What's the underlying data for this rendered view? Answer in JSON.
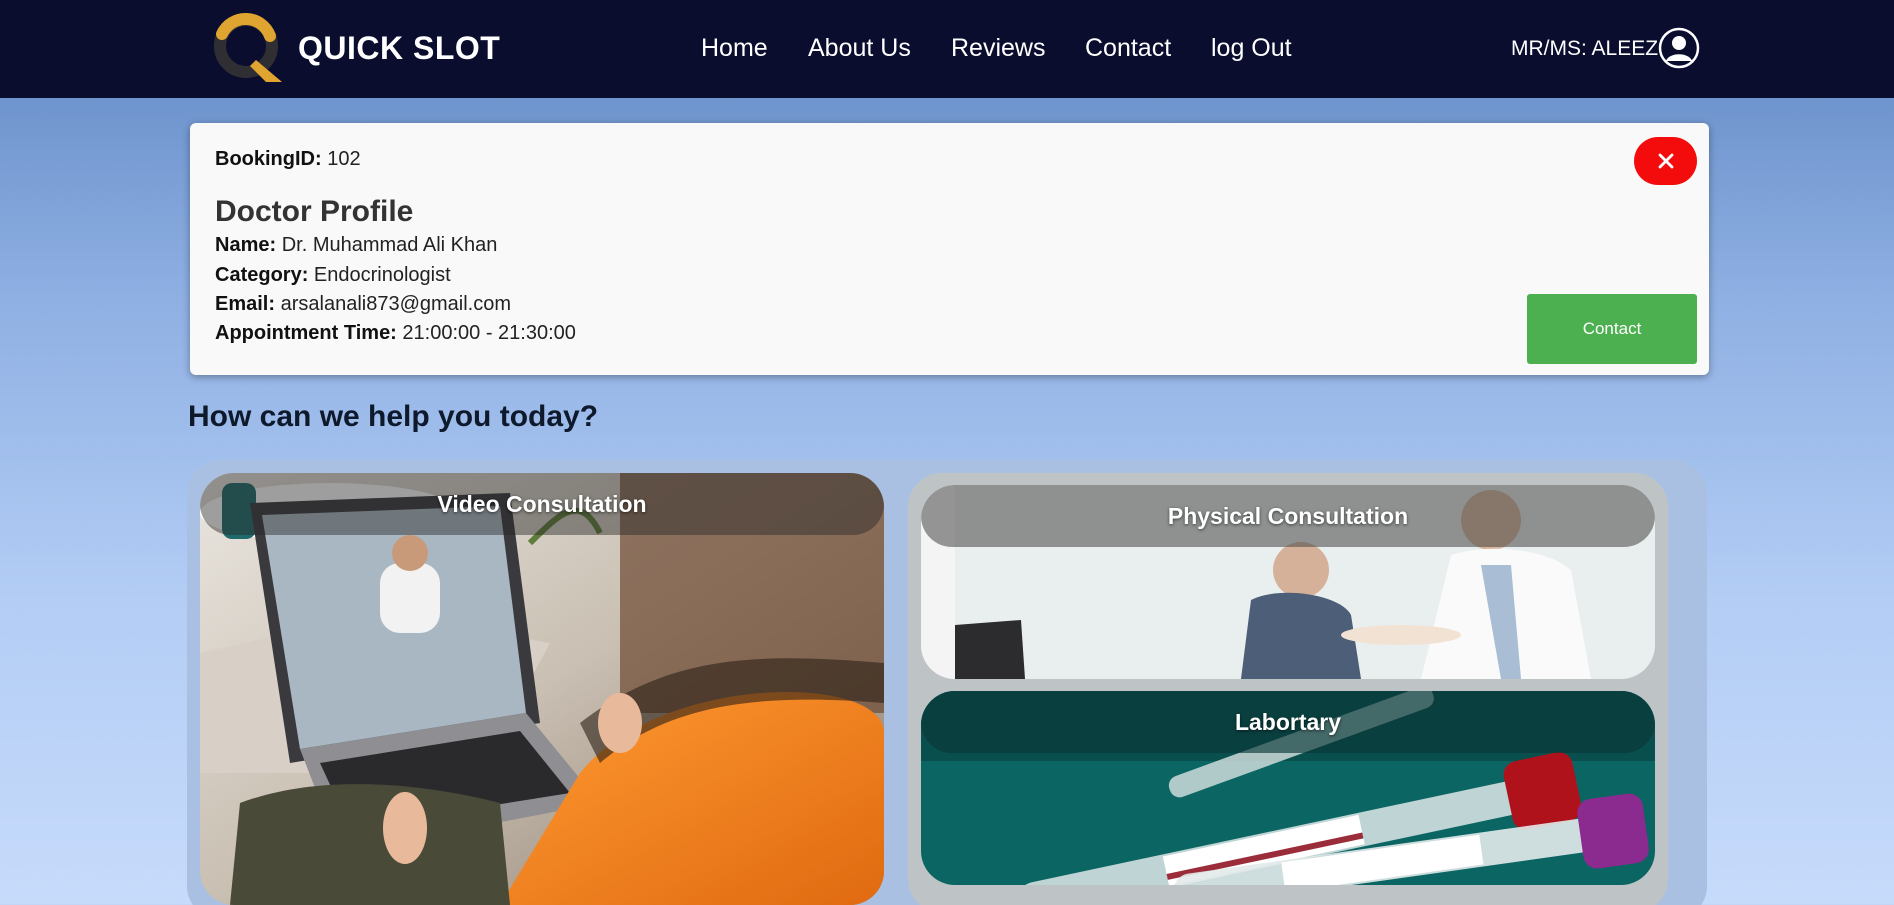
{
  "navbar": {
    "brand": "QUICK SLOT",
    "links": [
      "Home",
      "About Us",
      "Reviews",
      "Contact",
      "log Out"
    ],
    "user_label": "MR/MS: ALEEZ"
  },
  "booking": {
    "booking_id_label": "BookingID:",
    "booking_id_value": "102",
    "profile_title": "Doctor Profile",
    "name_label": "Name:",
    "name_value": "Dr. Muhammad Ali Khan",
    "category_label": "Category:",
    "category_value": "Endocrinologist",
    "email_label": "Email:",
    "email_value": "arsalanali873@gmail.com",
    "time_label": "Appointment Time:",
    "time_value": "21:00:00 - 21:30:00",
    "close_label": "✕",
    "contact_label": "Contact"
  },
  "help_heading": "How can we help you today?",
  "services": [
    {
      "label": "Video Consultation"
    },
    {
      "label": "Physical Consultation"
    },
    {
      "label": "Labortary"
    }
  ],
  "colors": {
    "navbar_bg": "#0b0d2e",
    "close_button": "#f40b0b",
    "contact_button": "#4caf50",
    "logo_gold": "#e0a530"
  },
  "icons": [
    "logo-mark",
    "user-avatar-icon",
    "close-icon"
  ]
}
